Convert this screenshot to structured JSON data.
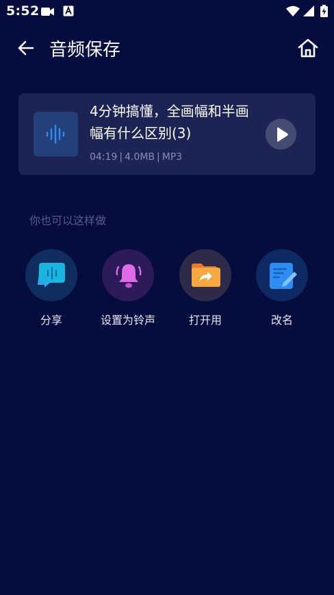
{
  "status_bar": {
    "time": "5:52"
  },
  "header": {
    "title": "音频保存"
  },
  "audio": {
    "title": "4分钟搞懂，全画幅和半画幅有什么区别(3)",
    "duration": "04:19",
    "size": "4.0MB",
    "format": "MP3"
  },
  "section": {
    "label": "你也可以这样做"
  },
  "actions": [
    {
      "label": "分享",
      "icon": "share-icon",
      "circle_color": "#0f2d5e"
    },
    {
      "label": "设置为铃声",
      "icon": "bell-icon",
      "circle_color": "#2d1a58"
    },
    {
      "label": "打开用",
      "icon": "folder-open-icon",
      "circle_color": "#2d2b48"
    },
    {
      "label": "改名",
      "icon": "rename-icon",
      "circle_color": "#0e2a63"
    }
  ],
  "colors": {
    "background": "#050d3e",
    "card": "#1c2453",
    "muted_text": "#8a90b4",
    "section_label": "#565d86"
  }
}
